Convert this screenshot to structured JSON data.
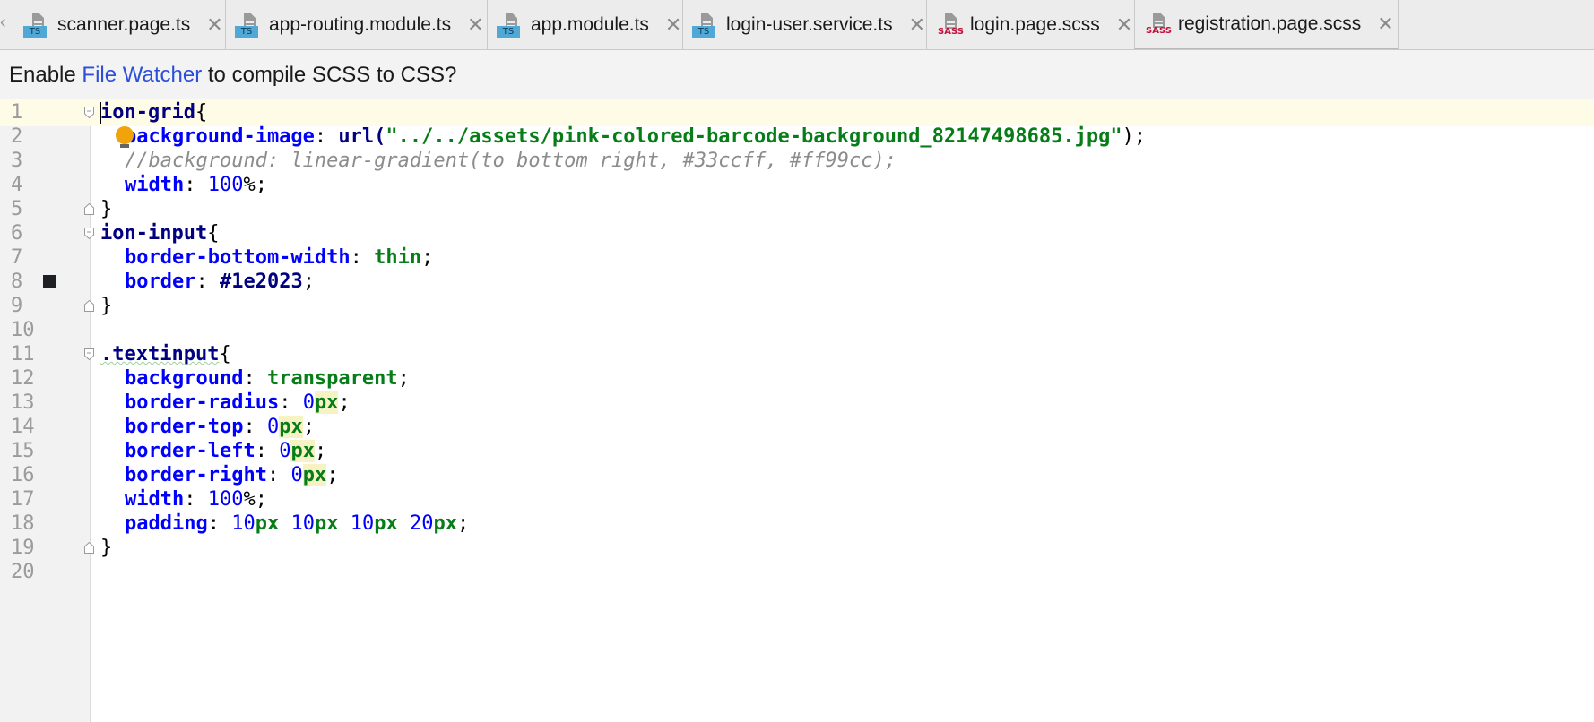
{
  "tabs": [
    {
      "label": "scanner.page.ts",
      "badge": "TS",
      "type": "ts"
    },
    {
      "label": "app-routing.module.ts",
      "badge": "TS",
      "type": "ts"
    },
    {
      "label": "app.module.ts",
      "badge": "TS",
      "type": "ts"
    },
    {
      "label": "login-user.service.ts",
      "badge": "TS",
      "type": "ts"
    },
    {
      "label": "login.page.scss",
      "badge": "SASS",
      "type": "sass"
    },
    {
      "label": "registration.page.scss",
      "badge": "SASS",
      "type": "sass",
      "active": true
    }
  ],
  "notification": {
    "prefix": "Enable ",
    "link": "File Watcher",
    "suffix": " to compile SCSS to CSS?"
  },
  "line_numbers": [
    "1",
    "2",
    "3",
    "4",
    "5",
    "6",
    "7",
    "8",
    "9",
    "10",
    "11",
    "12",
    "13",
    "14",
    "15",
    "16",
    "17",
    "18",
    "19",
    "20"
  ],
  "code": {
    "l1": {
      "selector": "ion-grid",
      "brace": "{"
    },
    "l2": {
      "prop": "background-image",
      "colon": ": ",
      "fn": "url(",
      "str": "\"../../assets/pink-colored-barcode-background_82147498685.jpg\"",
      "end": ");"
    },
    "l3": {
      "comment": "//background: linear-gradient(to bottom right, #33ccff, #ff99cc);"
    },
    "l4": {
      "prop": "width",
      "colon": ": ",
      "num": "100",
      "end": "%;"
    },
    "l5": {
      "brace": "}"
    },
    "l6": {
      "selector": "ion-input",
      "brace": "{"
    },
    "l7": {
      "prop": "border-bottom-width",
      "colon": ": ",
      "kw": "thin",
      "end": ";"
    },
    "l8": {
      "prop": "border",
      "colon": ": ",
      "val": "#1e2023",
      "end": ";"
    },
    "l9": {
      "brace": "}"
    },
    "l11": {
      "selector": ".textinput",
      "brace": "{"
    },
    "l12": {
      "prop": "background",
      "colon": ": ",
      "kw": "transparent",
      "end": ";"
    },
    "l13": {
      "prop": "border-radius",
      "colon": ": ",
      "num": "0",
      "unit": "px",
      "end": ";"
    },
    "l14": {
      "prop": "border-top",
      "colon": ": ",
      "num": "0",
      "unit": "px",
      "end": ";"
    },
    "l15": {
      "prop": "border-left",
      "colon": ": ",
      "num": "0",
      "unit": "px",
      "end": ";"
    },
    "l16": {
      "prop": "border-right",
      "colon": ": ",
      "num": "0",
      "unit": "px",
      "end": ";"
    },
    "l17": {
      "prop": "width",
      "colon": ": ",
      "num": "100",
      "end": "%;"
    },
    "l18": {
      "prop": "padding",
      "colon": ": ",
      "n1": "10",
      "u1": "px",
      "n2": "10",
      "u2": "px",
      "n3": "10",
      "u3": "px",
      "n4": "20",
      "u4": "px",
      "end": ";"
    },
    "l19": {
      "brace": "}"
    }
  },
  "colors": {
    "swatch": "#1e2023",
    "link": "#2c4fd8",
    "current_line": "#fefbe7"
  }
}
